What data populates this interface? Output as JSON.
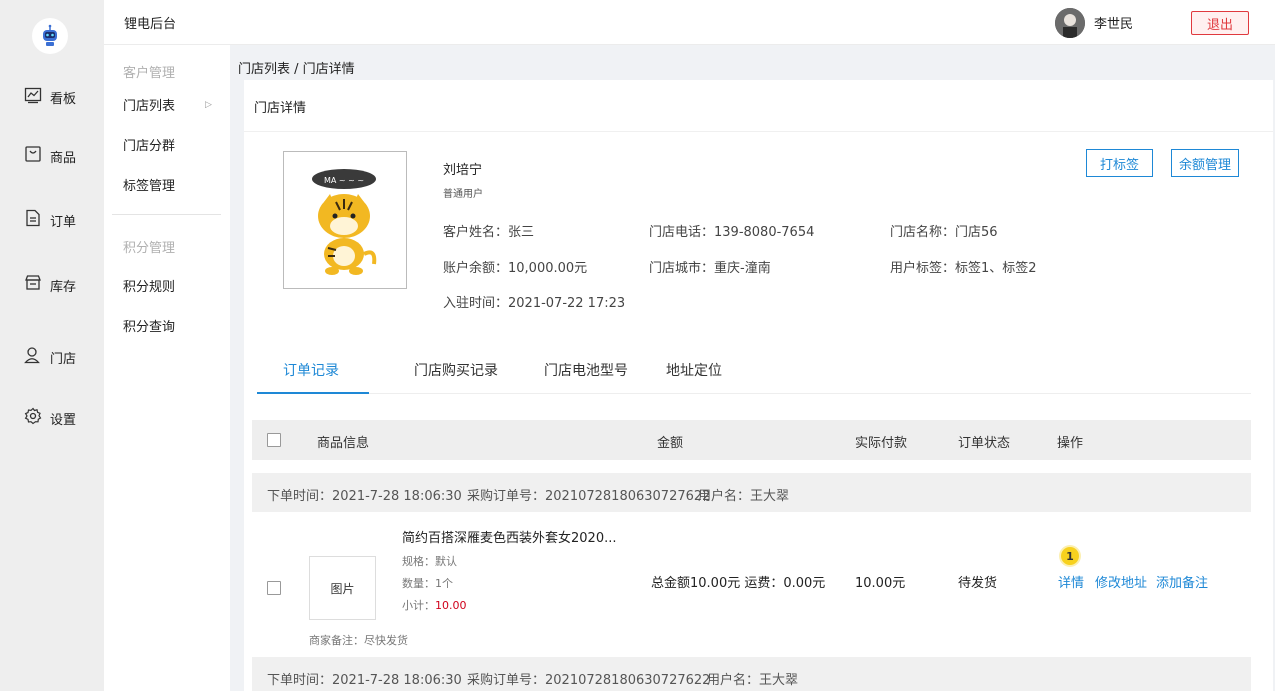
{
  "topbar": {
    "app_title": "锂电后台",
    "username": "李世民",
    "logout_label": "退出"
  },
  "rail": {
    "items": [
      {
        "label": "看板",
        "icon": "chart-icon"
      },
      {
        "label": "商品",
        "icon": "bag-icon"
      },
      {
        "label": "订单",
        "icon": "document-icon"
      },
      {
        "label": "库存",
        "icon": "store-icon"
      },
      {
        "label": "门店",
        "icon": "user-icon"
      },
      {
        "label": "设置",
        "icon": "gear-icon"
      }
    ]
  },
  "subnav": {
    "group1": "客户管理",
    "items1": [
      "门店列表",
      "门店分群",
      "标签管理"
    ],
    "group2": "积分管理",
    "items2": [
      "积分规则",
      "积分查询"
    ]
  },
  "breadcrumb": "门店列表 / 门店详情",
  "card": {
    "title": "门店详情",
    "profile": {
      "name": "刘培宁",
      "type": "普通用户"
    },
    "buttons": {
      "tag": "打标签",
      "balance": "余额管理"
    },
    "info": {
      "customer_name": "客户姓名：张三",
      "phone": "门店电话：139-8080-7654",
      "store_name": "门店名称：门店56",
      "balance": "账户余额：10,000.00元",
      "city": "门店城市：重庆-潼南",
      "tags": "用户标签：标签1、标签2",
      "joined": "入驻时间：2021-07-22 17:23"
    },
    "tabs": [
      "订单记录",
      "门店购买记录",
      "门店电池型号",
      "地址定位"
    ]
  },
  "table": {
    "headers": [
      "商品信息",
      "金额",
      "实际付款",
      "订单状态",
      "操作"
    ],
    "orders": [
      {
        "time": "下单时间：2021-7-28 18:06:30",
        "order_no": "采购订单号：20210728180630727622",
        "user": "用户名：王大翠"
      },
      {
        "time": "下单时间：2021-7-28 18:06:30",
        "order_no": "采购订单号：20210728180630727622",
        "user": "用户名：王大翠"
      }
    ],
    "row": {
      "img_label": "图片",
      "title": "简约百搭深雁麦色西装外套女2020...",
      "spec": "规格：默认",
      "qty": "数量：1个",
      "subtotal_label": "小计：",
      "subtotal_value": "10.00",
      "note": "商家备注：尽快发货",
      "amount": "总金额10.00元  运费：0.00元",
      "paid": "10.00元",
      "status": "待发货",
      "actions": [
        "详情",
        "修改地址",
        "添加备注"
      ],
      "badge": "1"
    }
  },
  "colors": {
    "accent": "#1e88d6",
    "danger": "#e0393e",
    "badge": "#f7d11e"
  }
}
